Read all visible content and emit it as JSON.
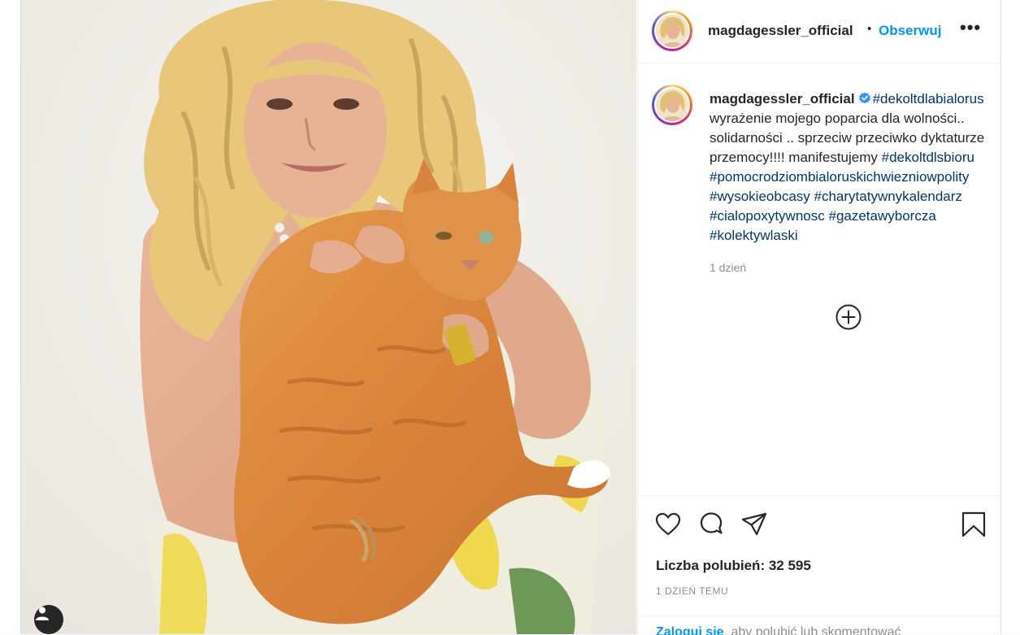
{
  "post": {
    "username": "magdagessler_official",
    "header_separator": "•",
    "follow_label": "Obserwuj",
    "more_label": "•••",
    "caption_lines": [
      {
        "text": " wyrażenie mojego poparcia dla wolności.."
      },
      {
        "text": "solidarności .. sprzeciw przeciwko dyktaturze"
      },
      {
        "pre": "przemocy!!!! manifestujemy ",
        "tag": "#dekoltdlsbioru"
      },
      {
        "tag": "#pomocrodziombialoruskichwiezniowpolity"
      },
      {
        "tag": "#wysokieobcasy",
        "sep": " ",
        "tag2": "#charytatywnykalendarz"
      },
      {
        "tag": "#cialopoxytywnosc",
        "sep": " ",
        "tag2": "#gazetawyborcza"
      },
      {
        "tag": "#kolektywlaski"
      }
    ],
    "caption_first_tag": "#dekoltdlabialorus",
    "caption_time": "1 dzień",
    "likes_label": "Liczba polubień: 32 595",
    "post_time": "1 DZIEŃ TEMU",
    "login_link": "Zaloguj się",
    "login_rest": ", aby polubić lub skomentować"
  },
  "icons": {
    "like": "heart-icon",
    "comment": "comment-icon",
    "share": "send-icon",
    "save": "bookmark-icon",
    "load_more": "plus-circle-icon",
    "user_tag": "user-icon",
    "verified": "verified-badge-icon"
  },
  "colors": {
    "accent": "#0095f6",
    "hashtag": "#00376b",
    "muted": "#8e8e8e",
    "text": "#262626"
  }
}
